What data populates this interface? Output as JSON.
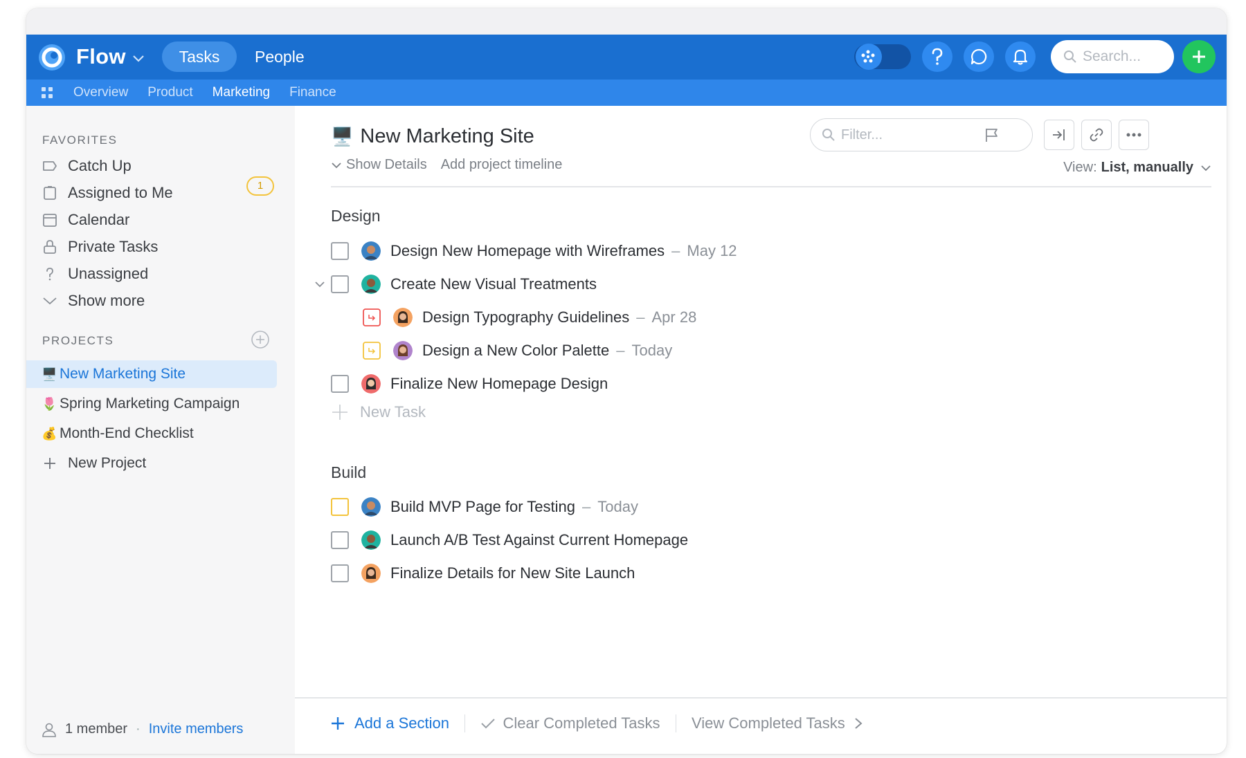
{
  "app": {
    "brand": "Flow",
    "top_nav": [
      "Tasks",
      "People"
    ],
    "search_placeholder": "Search...",
    "accent": "#1a6fd0",
    "add_color": "#22c55e"
  },
  "subnav": [
    "Overview",
    "Product",
    "Marketing",
    "Finance"
  ],
  "sidebar": {
    "favorites_heading": "FAVORITES",
    "favorites": [
      {
        "label": "Catch Up",
        "icon": "tag-icon"
      },
      {
        "label": "Assigned to Me",
        "icon": "clipboard-icon",
        "badge": "1"
      },
      {
        "label": "Calendar",
        "icon": "calendar-icon"
      },
      {
        "label": "Private Tasks",
        "icon": "lock-icon"
      },
      {
        "label": "Unassigned",
        "icon": "question-icon"
      },
      {
        "label": "Show more",
        "icon": "chevron-down-icon"
      }
    ],
    "projects_heading": "PROJECTS",
    "projects": [
      {
        "label": "New Marketing Site",
        "emoji": "🖥️"
      },
      {
        "label": "Spring Marketing Campaign",
        "emoji": "🌷"
      },
      {
        "label": "Month-End Checklist",
        "emoji": "💰"
      },
      {
        "label": "New Project",
        "emoji": "+"
      }
    ],
    "members": "1 member",
    "invite": "Invite members"
  },
  "main": {
    "emoji": "🖥️",
    "title": "New Marketing Site",
    "show_details": "Show Details",
    "add_timeline": "Add project timeline",
    "filter_placeholder": "Filter...",
    "view_label": "View:",
    "view_value": "List, manually",
    "sections": [
      {
        "title": "Design",
        "tasks": [
          {
            "name": "Design New Homepage with Wireframes",
            "date": "May 12"
          },
          {
            "name": "Create New Visual Treatments",
            "date": ""
          },
          {
            "name": "Design Typography Guidelines",
            "date": "Apr 28"
          },
          {
            "name": "Design a New Color Palette",
            "date": "Today"
          },
          {
            "name": "Finalize New Homepage Design",
            "date": ""
          }
        ],
        "new_task": "New Task"
      },
      {
        "title": "Build",
        "tasks": [
          {
            "name": "Build MVP Page for Testing",
            "date": "Today"
          },
          {
            "name": "Launch A/B Test Against Current Homepage",
            "date": ""
          },
          {
            "name": "Finalize Details for New Site Launch",
            "date": ""
          }
        ]
      }
    ],
    "date_sep": "–",
    "footer": {
      "add_section": "Add a Section",
      "clear_completed": "Clear Completed Tasks",
      "view_completed": "View Completed Tasks"
    }
  }
}
